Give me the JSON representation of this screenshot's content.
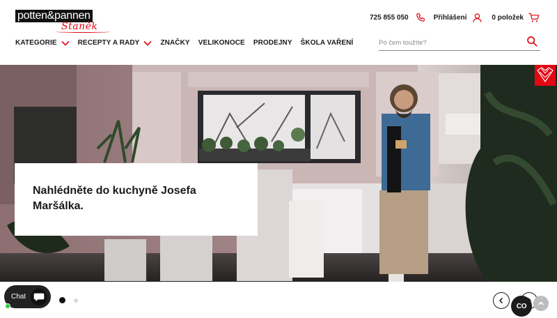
{
  "brand": {
    "logo_main": "potten&pannen",
    "logo_script": "Staněk",
    "accent_color": "#e30613"
  },
  "header": {
    "phone": "725 855 050",
    "phone_icon": "phone-icon",
    "login_label": "Přihlášení",
    "login_icon": "user-icon",
    "cart_label": "0 položek",
    "cart_icon": "cart-icon"
  },
  "nav": {
    "items": [
      {
        "label": "KATEGORIE",
        "has_dropdown": true
      },
      {
        "label": "RECEPTY A RADY",
        "has_dropdown": true
      },
      {
        "label": "ZNAČKY",
        "has_dropdown": false
      },
      {
        "label": "VELIKONOCE",
        "has_dropdown": false
      },
      {
        "label": "PRODEJNY",
        "has_dropdown": false
      },
      {
        "label": "ŠKOLA VAŘENÍ",
        "has_dropdown": false
      }
    ]
  },
  "search": {
    "placeholder": "Po čem toužíte?",
    "value": "",
    "icon": "search-icon"
  },
  "hero": {
    "title": "Nahlédněte do kuchyně Josefa Maršálka.",
    "slides_total": 2,
    "active_slide": 1
  },
  "chat": {
    "label": "Chat",
    "status": "online"
  },
  "widgets": {
    "co_badge": "CO"
  }
}
